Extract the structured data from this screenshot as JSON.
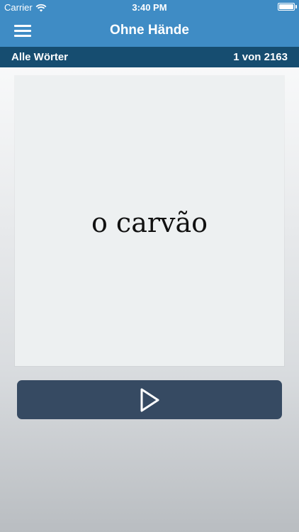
{
  "status_bar": {
    "carrier": "Carrier",
    "time": "3:40 PM",
    "battery_level": 1.0
  },
  "nav": {
    "title": "Ohne Hände",
    "menu_icon": "hamburger-menu-icon"
  },
  "sub_bar": {
    "left_label": "Alle Wörter",
    "counter": "1 von 2163"
  },
  "card": {
    "word": "o carvão"
  },
  "controls": {
    "play_icon": "play-icon"
  },
  "colors": {
    "header": "#3f8cc5",
    "sub_bar": "#164d70",
    "card": "#edf0f1",
    "play_button": "#364a62"
  }
}
